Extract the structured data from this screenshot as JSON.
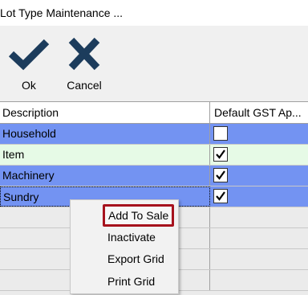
{
  "window": {
    "title": "Lot Type Maintenance ..."
  },
  "toolbar": {
    "ok": {
      "label": "Ok",
      "icon": "checkmark-icon"
    },
    "cancel": {
      "label": "Cancel",
      "icon": "x-icon"
    }
  },
  "grid": {
    "columns": [
      "Description",
      "Default GST Ap..."
    ],
    "rows": [
      {
        "description": "Household",
        "gst": false
      },
      {
        "description": "Item",
        "gst": true
      },
      {
        "description": "Machinery",
        "gst": true
      },
      {
        "description": "Sundry",
        "gst": true
      }
    ]
  },
  "context_menu": {
    "items": [
      "Add To Sale",
      "Inactivate",
      "Export Grid",
      "Print Grid"
    ],
    "highlighted_index": 0
  },
  "colors": {
    "icon_navy": "#1c3c5c",
    "row_blue": "#7393f2",
    "row_green": "#e6fae6",
    "highlight_border": "#a6121d"
  }
}
